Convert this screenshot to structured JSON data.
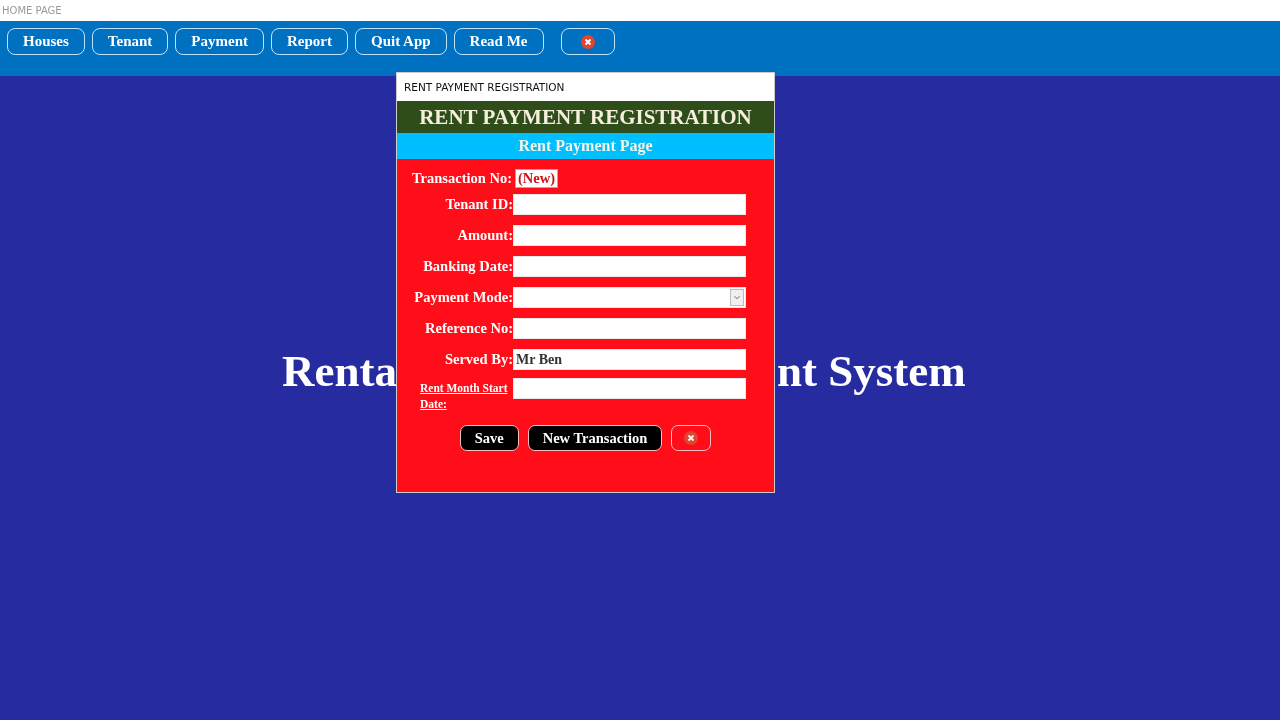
{
  "window": {
    "title": "HOME PAGE"
  },
  "toolbar": [
    {
      "label": "Houses",
      "kind": "text"
    },
    {
      "label": "Tenant",
      "kind": "text"
    },
    {
      "label": "Payment",
      "kind": "text"
    },
    {
      "label": "Report",
      "kind": "text"
    },
    {
      "label": "Quit App",
      "kind": "text"
    },
    {
      "label": "Read Me",
      "kind": "text"
    },
    {
      "kind": "close"
    }
  ],
  "background_title": {
    "left_part": "Renta",
    "right_part": "nt System"
  },
  "dialog": {
    "title": "RENT PAYMENT REGISTRATION",
    "heading": "RENT PAYMENT REGISTRATION",
    "subheading": "Rent Payment Page",
    "transaction": {
      "label": "Transaction No:",
      "value": "(New)"
    },
    "fields": [
      {
        "label": "Tenant ID:",
        "kind": "text"
      },
      {
        "label": "Amount:",
        "kind": "text"
      },
      {
        "label": "Banking Date:",
        "kind": "text"
      },
      {
        "label": "Payment Mode:",
        "kind": "select"
      },
      {
        "label": "Reference No:",
        "kind": "text"
      },
      {
        "label": "Served By:",
        "kind": "text",
        "value": "Mr Ben"
      },
      {
        "label": "Rent Month Start Date:",
        "kind": "link"
      }
    ],
    "buttons": [
      {
        "label": "Save",
        "kind": "text"
      },
      {
        "label": "New Transaction",
        "kind": "text"
      },
      {
        "kind": "close"
      }
    ]
  }
}
